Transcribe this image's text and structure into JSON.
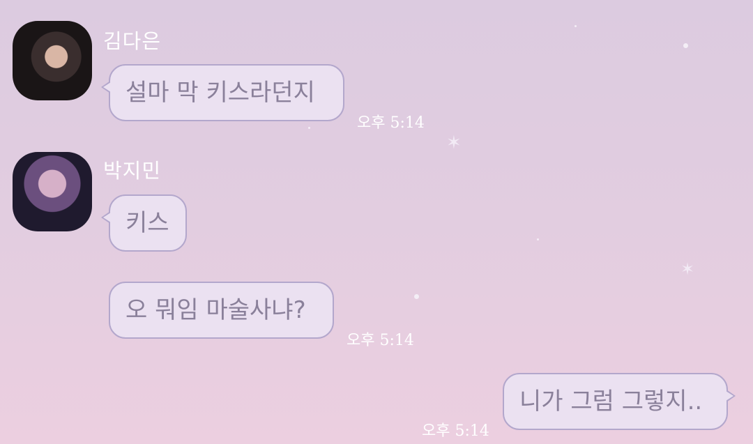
{
  "messages": [
    {
      "sender": "김다은",
      "text": "설마 막 키스라던지",
      "time": "오후 5:14"
    },
    {
      "sender": "박지민",
      "text": "키스",
      "time": ""
    },
    {
      "sender": "박지민",
      "text": "오 뭐임 마술사냐?",
      "time": "오후 5:14"
    },
    {
      "sender": "me",
      "text": "니가 그럼 그렇지..",
      "time": "오후 5:14"
    }
  ],
  "icons": {
    "sparkle": "sparkle-icon"
  }
}
